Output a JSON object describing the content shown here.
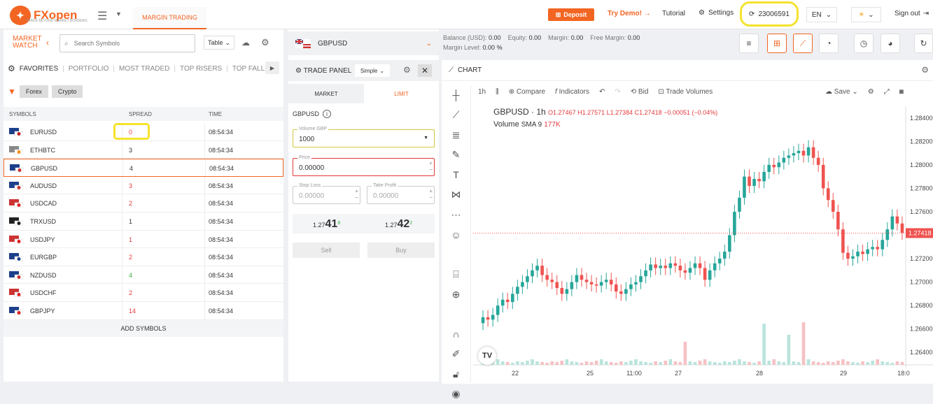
{
  "header": {
    "brand": "FXopen",
    "brand_sub": "TRADE BEYOND MARKET BORDERS",
    "tab": "MARGIN TRADING",
    "deposit": "Deposit",
    "try_demo": "Try Demo!",
    "tutorial": "Tutorial",
    "settings": "Settings",
    "account": "23006591",
    "lang": "EN",
    "signout": "Sign out"
  },
  "market_watch": {
    "title_1": "MARKET",
    "title_2": "WATCH",
    "search_placeholder": "Search Symbols",
    "view": "Table",
    "categories": [
      "FAVORITES",
      "PORTFOLIO",
      "MOST TRADED",
      "TOP RISERS",
      "TOP FALLERS"
    ],
    "filters": [
      "Forex",
      "Crypto"
    ],
    "columns": [
      "SYMBOLS",
      "SPREAD",
      "TIME"
    ],
    "rows": [
      {
        "symbol": "EURUSD",
        "spread": "0",
        "time": "08:54:34",
        "color": "red"
      },
      {
        "symbol": "ETHBTC",
        "spread": "3",
        "time": "08:54:34",
        "color": "dark"
      },
      {
        "symbol": "GBPUSD",
        "spread": "4",
        "time": "08:54:34",
        "color": "dark"
      },
      {
        "symbol": "AUDUSD",
        "spread": "3",
        "time": "08:54:34",
        "color": "red"
      },
      {
        "symbol": "USDCAD",
        "spread": "2",
        "time": "08:54:34",
        "color": "red"
      },
      {
        "symbol": "TRXUSD",
        "spread": "1",
        "time": "08:54:34",
        "color": "dark"
      },
      {
        "symbol": "USDJPY",
        "spread": "1",
        "time": "08:54:34",
        "color": "red"
      },
      {
        "symbol": "EURGBP",
        "spread": "2",
        "time": "08:54:34",
        "color": "red"
      },
      {
        "symbol": "NZDUSD",
        "spread": "4",
        "time": "08:54:34",
        "color": "green"
      },
      {
        "symbol": "USDCHF",
        "spread": "2",
        "time": "08:54:34",
        "color": "red"
      },
      {
        "symbol": "GBPJPY",
        "spread": "14",
        "time": "08:54:34",
        "color": "red"
      }
    ],
    "add_symbols": "ADD SYMBOLS"
  },
  "trade_panel": {
    "symbol": "GBPUSD",
    "title": "TRADE PANEL",
    "mode": "Simple",
    "tab_market": "MARKET",
    "tab_limit": "LIMIT",
    "instrument": "GBPUSD",
    "volume_label": "Volume GBP",
    "volume_value": "1000",
    "price_label": "Price",
    "price_value": "0.00000",
    "stop_loss_label": "Stop Loss",
    "stop_loss_placeholder": "0.00000",
    "take_profit_label": "Take Profit",
    "take_profit_placeholder": "0.00000",
    "sell_quote_prefix": "1.27",
    "sell_quote_big": "41",
    "sell_quote_sup": "8",
    "buy_quote_prefix": "1.27",
    "buy_quote_big": "42",
    "buy_quote_sup": "2",
    "sell": "Sell",
    "buy": "Buy"
  },
  "account_info": {
    "balance_label": "Balance (USD):",
    "balance": "0.00",
    "equity_label": "Equity:",
    "equity": "0.00",
    "margin_label": "Margin:",
    "margin": "0.00",
    "free_margin_label": "Free Margin:",
    "free_margin": "0.00",
    "margin_level_label": "Margin Level:",
    "margin_level": "0.00 %"
  },
  "chart": {
    "title": "CHART",
    "interval": "1h",
    "compare": "Compare",
    "indicators": "Indicators",
    "bid": "Bid",
    "trade_volumes": "Trade Volumes",
    "save": "Save",
    "legend_symbol": "GBPUSD · 1h",
    "ohlc": "O1.27467 H1.27571 L1.27384 C1.27418 −0.00051 (−0.04%)",
    "volume_label": "Volume",
    "volume_sma": "SMA 9",
    "volume_value": "177K",
    "current_price": "1.27418"
  },
  "chart_data": {
    "type": "candlestick",
    "y_ticks": [
      "1.28400",
      "1.28200",
      "1.28000",
      "1.27800",
      "1.27600",
      "1.27400",
      "1.27200",
      "1.27000",
      "1.26800",
      "1.26600",
      "1.26400"
    ],
    "ylim": [
      1.263,
      1.285
    ],
    "x_ticks": [
      "22",
      "25",
      "11:00",
      "27",
      "28",
      "29",
      "18:0"
    ],
    "last_price": 1.27418
  }
}
